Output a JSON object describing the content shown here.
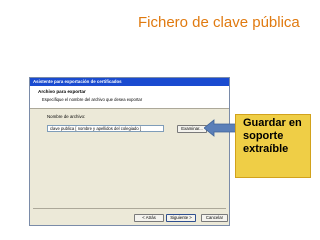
{
  "slide": {
    "title": "Fichero de clave pública"
  },
  "dialog": {
    "title": "Asistente para exportación de certificados",
    "header_title": "Archivo para exportar",
    "header_subtitle": "Especifique el nombre del archivo que desea exportar",
    "field_label": "Nombre de archivo:",
    "file_value": "clave publica [ nombre y apellidos del colegiado ]",
    "browse_label": "Examinar...",
    "back_label": "< Atrás",
    "next_label": "Siguiente >",
    "cancel_label": "Cancelar"
  },
  "callout": {
    "text": "Guardar en soporte extraíble"
  },
  "colors": {
    "title": "#e07a10",
    "callout_fill": "#efce46",
    "arrow": "#5b7fb8",
    "dialog_titlebar": "#1a4bd0"
  }
}
